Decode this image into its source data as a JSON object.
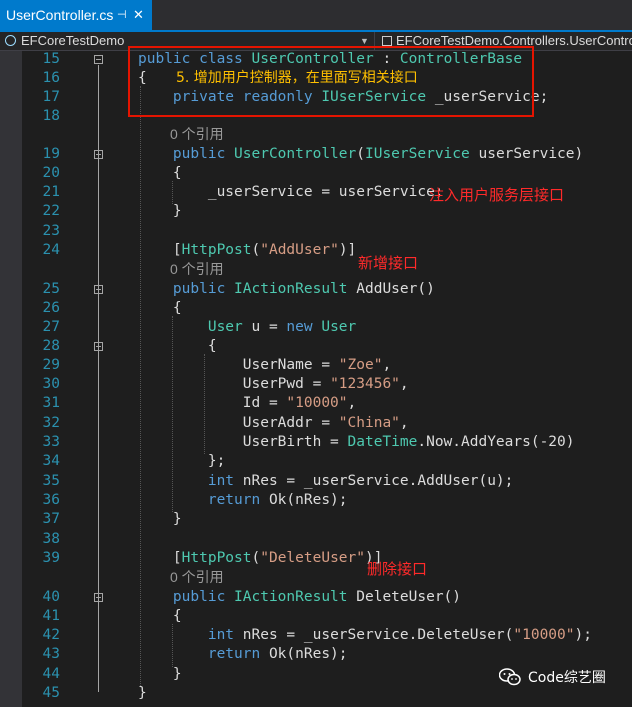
{
  "tab": {
    "title": "UserController.cs",
    "pin": "⊣",
    "close": "✕"
  },
  "nav": {
    "project": "EFCoreTestDemo",
    "scope": "EFCoreTestDemo.Controllers.UserControllo"
  },
  "refs_label": "0 个引用",
  "lines": [
    {
      "n": "15",
      "segs": [
        {
          "t": "public class ",
          "c": "kw"
        },
        {
          "t": "UserController",
          "c": "ty"
        },
        {
          "t": " : "
        },
        {
          "t": "ControllerBase",
          "c": "ty"
        }
      ]
    },
    {
      "n": "16",
      "segs": [
        {
          "t": "{"
        }
      ]
    },
    {
      "n": "17",
      "segs": [
        {
          "t": "    private readonly ",
          "c": "kw"
        },
        {
          "t": "IUserService",
          "c": "ty"
        },
        {
          "t": " _userService;"
        }
      ]
    },
    {
      "n": "18",
      "segs": []
    },
    {
      "n": "19",
      "segs": [
        {
          "t": "    public ",
          "c": "kw"
        },
        {
          "t": "UserController",
          "c": "ty"
        },
        {
          "t": "("
        },
        {
          "t": "IUserService",
          "c": "ty"
        },
        {
          "t": " userService)"
        }
      ]
    },
    {
      "n": "20",
      "segs": [
        {
          "t": "    {"
        }
      ]
    },
    {
      "n": "21",
      "segs": [
        {
          "t": "        _userService = userService;"
        }
      ]
    },
    {
      "n": "22",
      "segs": [
        {
          "t": "    }"
        }
      ]
    },
    {
      "n": "23",
      "segs": []
    },
    {
      "n": "24",
      "segs": [
        {
          "t": "    ["
        },
        {
          "t": "HttpPost",
          "c": "ty"
        },
        {
          "t": "("
        },
        {
          "t": "\"AddUser\"",
          "c": "st"
        },
        {
          "t": ")]"
        }
      ]
    },
    {
      "n": "25",
      "segs": [
        {
          "t": "    public ",
          "c": "kw"
        },
        {
          "t": "IActionResult",
          "c": "ty"
        },
        {
          "t": " AddUser()"
        }
      ]
    },
    {
      "n": "26",
      "segs": [
        {
          "t": "    {"
        }
      ]
    },
    {
      "n": "27",
      "segs": [
        {
          "t": "        "
        },
        {
          "t": "User",
          "c": "ty"
        },
        {
          "t": " u = "
        },
        {
          "t": "new ",
          "c": "kw"
        },
        {
          "t": "User",
          "c": "ty"
        }
      ]
    },
    {
      "n": "28",
      "segs": [
        {
          "t": "        {"
        }
      ]
    },
    {
      "n": "29",
      "segs": [
        {
          "t": "            UserName = "
        },
        {
          "t": "\"Zoe\"",
          "c": "st"
        },
        {
          "t": ","
        }
      ]
    },
    {
      "n": "30",
      "segs": [
        {
          "t": "            UserPwd = "
        },
        {
          "t": "\"123456\"",
          "c": "st"
        },
        {
          "t": ","
        }
      ]
    },
    {
      "n": "31",
      "segs": [
        {
          "t": "            Id = "
        },
        {
          "t": "\"10000\"",
          "c": "st"
        },
        {
          "t": ","
        }
      ]
    },
    {
      "n": "32",
      "segs": [
        {
          "t": "            UserAddr = "
        },
        {
          "t": "\"China\"",
          "c": "st"
        },
        {
          "t": ","
        }
      ]
    },
    {
      "n": "33",
      "segs": [
        {
          "t": "            UserBirth = "
        },
        {
          "t": "DateTime",
          "c": "ty"
        },
        {
          "t": ".Now.AddYears(-20)"
        }
      ]
    },
    {
      "n": "34",
      "segs": [
        {
          "t": "        };"
        }
      ]
    },
    {
      "n": "35",
      "segs": [
        {
          "t": "        "
        },
        {
          "t": "int ",
          "c": "kw"
        },
        {
          "t": "nRes = _userService.AddUser(u);"
        }
      ]
    },
    {
      "n": "36",
      "segs": [
        {
          "t": "        "
        },
        {
          "t": "return ",
          "c": "kw"
        },
        {
          "t": "Ok(nRes);"
        }
      ]
    },
    {
      "n": "37",
      "segs": [
        {
          "t": "    }"
        }
      ]
    },
    {
      "n": "38",
      "segs": []
    },
    {
      "n": "39",
      "segs": [
        {
          "t": "    ["
        },
        {
          "t": "HttpPost",
          "c": "ty"
        },
        {
          "t": "("
        },
        {
          "t": "\"DeleteUser\"",
          "c": "st"
        },
        {
          "t": ")]"
        }
      ]
    },
    {
      "n": "40",
      "segs": [
        {
          "t": "    public ",
          "c": "kw"
        },
        {
          "t": "IActionResult",
          "c": "ty"
        },
        {
          "t": " DeleteUser()"
        }
      ]
    },
    {
      "n": "41",
      "segs": [
        {
          "t": "    {"
        }
      ]
    },
    {
      "n": "42",
      "segs": [
        {
          "t": "        "
        },
        {
          "t": "int ",
          "c": "kw"
        },
        {
          "t": "nRes = _userService.DeleteUser("
        },
        {
          "t": "\"10000\"",
          "c": "st"
        },
        {
          "t": ");"
        }
      ]
    },
    {
      "n": "43",
      "segs": [
        {
          "t": "        "
        },
        {
          "t": "return ",
          "c": "kw"
        },
        {
          "t": "Ok(nRes);"
        }
      ]
    },
    {
      "n": "44",
      "segs": [
        {
          "t": "    }"
        }
      ]
    },
    {
      "n": "45",
      "segs": [
        {
          "t": "}"
        }
      ]
    }
  ],
  "annotations": {
    "step5": "5. 增加用户控制器，在里面写相关接口",
    "inject": "注入用户服务层接口",
    "add": "新增接口",
    "delete": "删除接口"
  },
  "watermark": {
    "text": "Code综艺圈"
  },
  "colors": {
    "keyword": "#569cd6",
    "type": "#4ec9b0",
    "string": "#d69d85",
    "line_number": "#2b91af",
    "annotation_red": "#ff2a2a",
    "annotation_yellow": "#ffc000",
    "highlight_box": "#e51400",
    "tab_accent": "#007acc"
  }
}
